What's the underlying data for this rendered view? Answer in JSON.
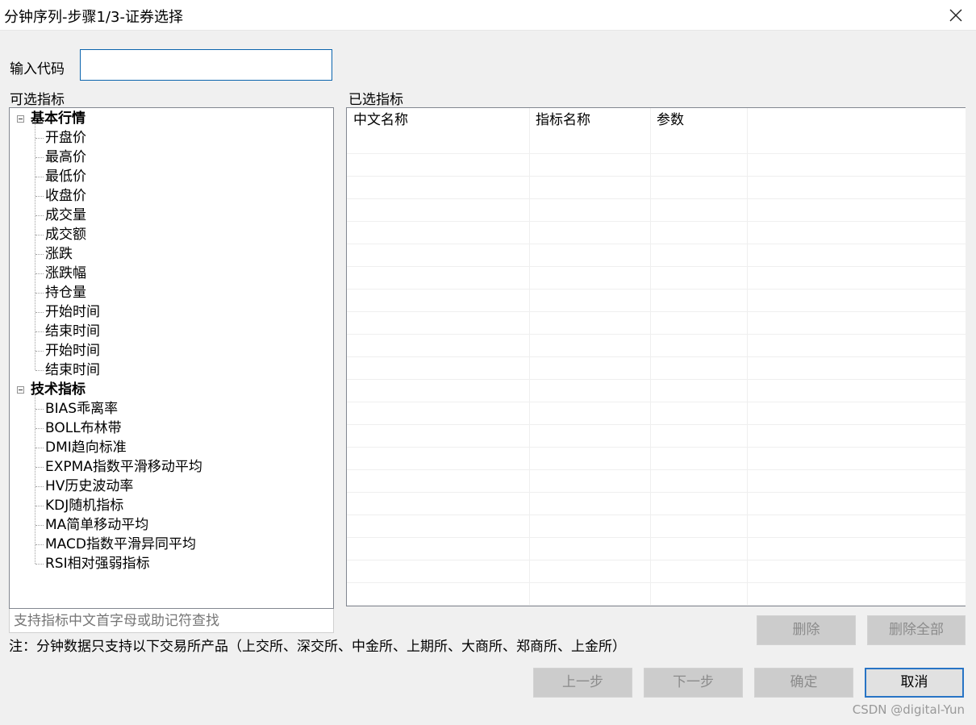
{
  "window": {
    "title": "分钟序列-步骤1/3-证券选择"
  },
  "code_input": {
    "label": "输入代码",
    "value": ""
  },
  "available": {
    "label": "可选指标",
    "categories": [
      {
        "name": "基本行情",
        "items": [
          "开盘价",
          "最高价",
          "最低价",
          "收盘价",
          "成交量",
          "成交额",
          "涨跌",
          "涨跌幅",
          "持仓量",
          "开始时间",
          "结束时间",
          "开始时间",
          "结束时间"
        ]
      },
      {
        "name": "技术指标",
        "items": [
          "BIAS乖离率",
          "BOLL布林带",
          "DMI趋向标准",
          "EXPMA指数平滑移动平均",
          "HV历史波动率",
          "KDJ随机指标",
          "MA简单移动平均",
          "MACD指数平滑异同平均",
          "RSI相对强弱指标"
        ]
      }
    ],
    "search_hint": "支持指标中文首字母或助记符查找"
  },
  "selected": {
    "label": "已选指标",
    "columns": [
      "中文名称",
      "指标名称",
      "参数"
    ],
    "rows": []
  },
  "buttons": {
    "delete": "删除",
    "delete_all": "删除全部",
    "prev": "上一步",
    "next": "下一步",
    "ok": "确定",
    "cancel": "取消"
  },
  "note": "注：分钟数据只支持以下交易所产品（上交所、深交所、中金所、上期所、大商所、郑商所、上金所）",
  "watermark": "CSDN @digital-Yun"
}
